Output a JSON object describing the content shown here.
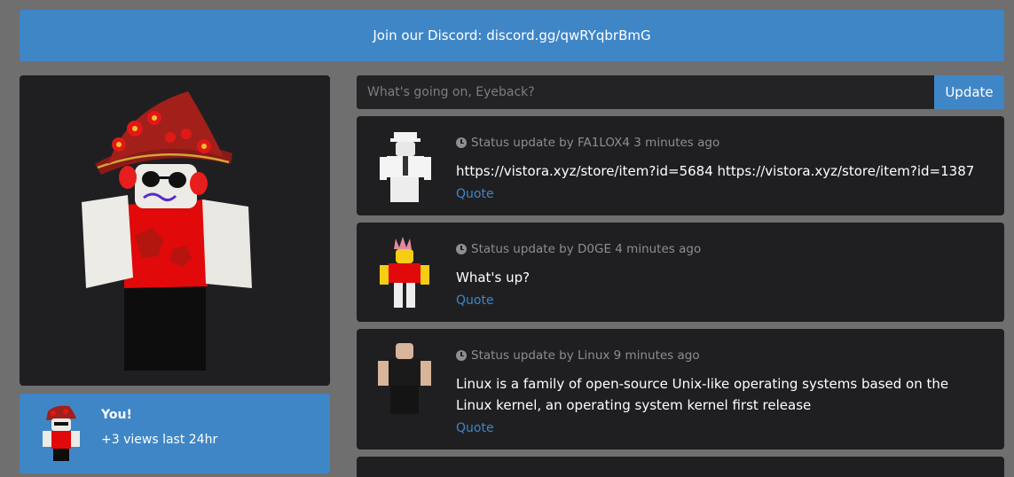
{
  "banner": {
    "text": "Join our Discord: discord.gg/qwRYqbrBmG"
  },
  "profile": {
    "name": "You!",
    "views": "+3 views last 24hr"
  },
  "status_form": {
    "placeholder": "What's going on, Eyeback?",
    "value": "",
    "button_label": "Update"
  },
  "feed": [
    {
      "meta": "Status update by FA1LOX4 3 minutes ago",
      "text": "https://vistora.xyz/store/item?id=5684 https://vistora.xyz/store/item?id=1387",
      "quote": "Quote"
    },
    {
      "meta": "Status update by D0GE 4 minutes ago",
      "text": "What's up?",
      "quote": "Quote"
    },
    {
      "meta": "Status update by Linux 9 minutes ago",
      "text": "Linux is a family of open-source Unix-like operating systems based on the Linux kernel, an operating system kernel first release",
      "quote": "Quote"
    }
  ],
  "colors": {
    "accent": "#3f86c7",
    "panel": "#1f1f22",
    "page_bg": "#6f6f6f"
  }
}
